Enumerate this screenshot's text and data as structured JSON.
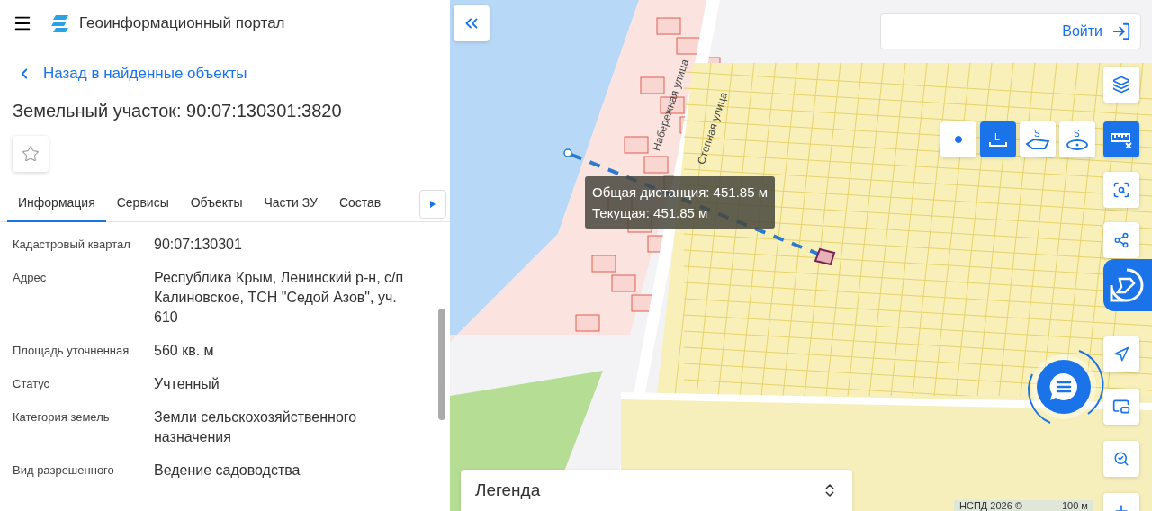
{
  "header": {
    "title": "Геоинформационный портал"
  },
  "back_link": "Назад в найденные объекты",
  "object_title": "Земельный участок: 90:07:130301:3820",
  "favorite": {
    "checked": false
  },
  "tabs": [
    {
      "label": "Информация",
      "selected": true
    },
    {
      "label": "Сервисы",
      "selected": false
    },
    {
      "label": "Объекты",
      "selected": false
    },
    {
      "label": "Части ЗУ",
      "selected": false
    },
    {
      "label": "Состав",
      "selected": false
    }
  ],
  "attributes": [
    {
      "label": "Кадастровый квартал",
      "value": "90:07:130301"
    },
    {
      "label": "Адрес",
      "value": "Республика Крым, Ленинский р-н, с/п Калиновское, ТСН \"Седой Азов\", уч. 610"
    },
    {
      "label": "Площадь уточненная",
      "value": "560 кв. м"
    },
    {
      "label": "Статус",
      "value": "Учтенный"
    },
    {
      "label": "Категория земель",
      "value": "Земли сельскохозяйственного назначения"
    },
    {
      "label": "Вид разрешенного",
      "value": "Ведение садоводства"
    }
  ],
  "map": {
    "login_button": "Войти",
    "street_labels": [
      "Набережная улица",
      "Степная улица"
    ],
    "tooltip": [
      "Общая дистанция: 451.85 м",
      "Текущая: 451.85 м"
    ],
    "measure_tools": [
      {
        "kind": "point",
        "selected": false
      },
      {
        "kind": "distance",
        "symbol": "L",
        "selected": true
      },
      {
        "kind": "polygon",
        "symbol": "S",
        "selected": false
      },
      {
        "kind": "circle",
        "symbol": "S",
        "selected": false
      }
    ],
    "side_tools": [
      {
        "kind": "layers",
        "selected": false
      },
      {
        "kind": "ruler",
        "selected": true
      },
      {
        "kind": "select",
        "selected": false
      },
      {
        "kind": "share",
        "selected": false
      },
      {
        "kind": "logo",
        "selected": true
      },
      {
        "kind": "navigate",
        "selected": false
      },
      {
        "kind": "minimap",
        "selected": false
      },
      {
        "kind": "locate",
        "selected": false
      },
      {
        "kind": "zoom",
        "selected": false
      }
    ],
    "legend": "Легенда",
    "attribution": "НСПД 2026 ©",
    "scale": "100 м"
  }
}
